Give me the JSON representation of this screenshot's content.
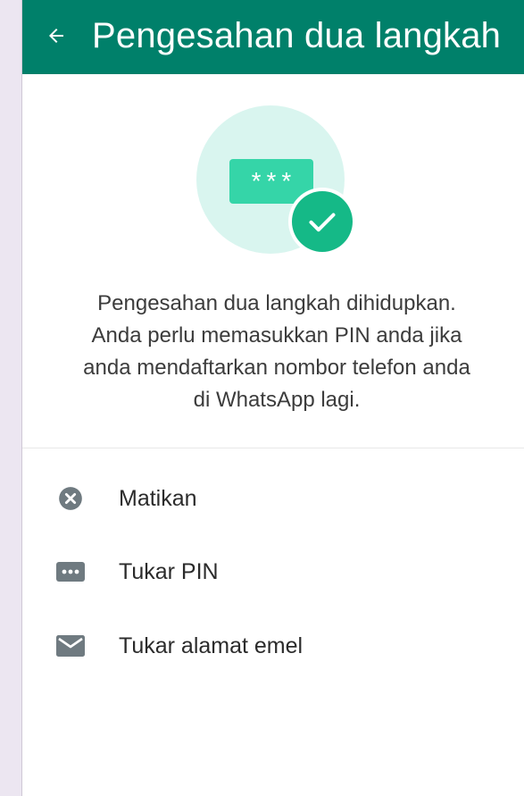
{
  "header": {
    "title": "Pengesahan dua langkah",
    "back_icon": "arrow-left-icon",
    "color": "#00806a"
  },
  "hero": {
    "pin_mask": "***",
    "circle_color": "#d9f5ef",
    "pin_color": "#35d5a8",
    "check_color": "#15b987"
  },
  "description": {
    "lines": [
      "Pengesahan dua langkah dihidupkan.",
      "Anda perlu memasukkan PIN anda jika",
      "anda mendaftarkan nombor telefon anda",
      "di WhatsApp lagi."
    ]
  },
  "options": [
    {
      "label": "Matikan",
      "icon": "close-circle-icon"
    },
    {
      "label": "Tukar PIN",
      "icon": "dots-pin-icon"
    },
    {
      "label": "Tukar alamat emel",
      "icon": "email-icon"
    }
  ],
  "colors": {
    "icon_gray": "#6f7a80",
    "background_side": "#ece6f1"
  }
}
